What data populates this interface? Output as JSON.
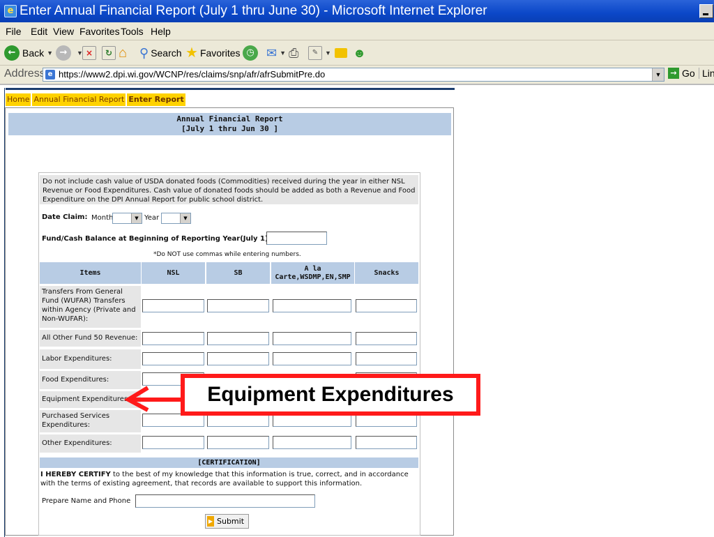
{
  "window": {
    "title": "Enter Annual Financial Report (July 1 thru June 30) - Microsoft Internet Explorer"
  },
  "menu": [
    "File",
    "Edit",
    "View",
    "Favorites",
    "Tools",
    "Help"
  ],
  "toolbar": {
    "back": "Back",
    "search": "Search",
    "favorites": "Favorites"
  },
  "address": {
    "label": "Address",
    "url": "https://www2.dpi.wi.gov/WCNP/res/claims/snp/afr/afrSubmitPre.do",
    "go": "Go",
    "links": "Lin"
  },
  "nav": {
    "home": "Home",
    "afr": "Annual Financial Report",
    "enter": "Enter Report"
  },
  "form": {
    "title_line1": "Annual Financial Report",
    "title_line2": "[July 1 thru Jun 30 ]",
    "note": "Do not include cash value of USDA donated foods (Commodities) received during the year in either NSL Revenue or Food Expenditures. Cash value of donated foods should be added as both a Revenue and Food Expenditure on the DPI Annual Report for public school district.",
    "date_claim": "Date Claim:",
    "month": "Month",
    "year": "Year",
    "fund_balance": "Fund/Cash Balance at Beginning of Reporting Year(July 1):",
    "commas_note": "*Do NOT use commas while entering numbers.",
    "columns": {
      "items": "Items",
      "nsl": "NSL",
      "sb": "SB",
      "alacarte_l1": "A la",
      "alacarte_l2": "Carte,WSDMP,EN,SMP",
      "snacks": "Snacks"
    },
    "rows": [
      "Transfers From General Fund (WUFAR) Transfers within Agency (Private and Non-WUFAR):",
      "All Other Fund 50 Revenue:",
      "Labor Expenditures:",
      "Food Expenditures:",
      "Equipment Expenditures:",
      "Purchased Services Expenditures:",
      "Other Expenditures:"
    ],
    "certification_title": "[CERTIFICATION]",
    "certify_bold": "I HEREBY CERTIFY",
    "certify_text": " to the best of my knowledge that this information is true, correct, and in accordance with the terms of existing agreement, that records are available to support this information.",
    "preparer": "Prepare Name and Phone",
    "submit": "Submit"
  },
  "callout": {
    "text": "Equipment Expenditures",
    "color": "#ff1a1a"
  }
}
